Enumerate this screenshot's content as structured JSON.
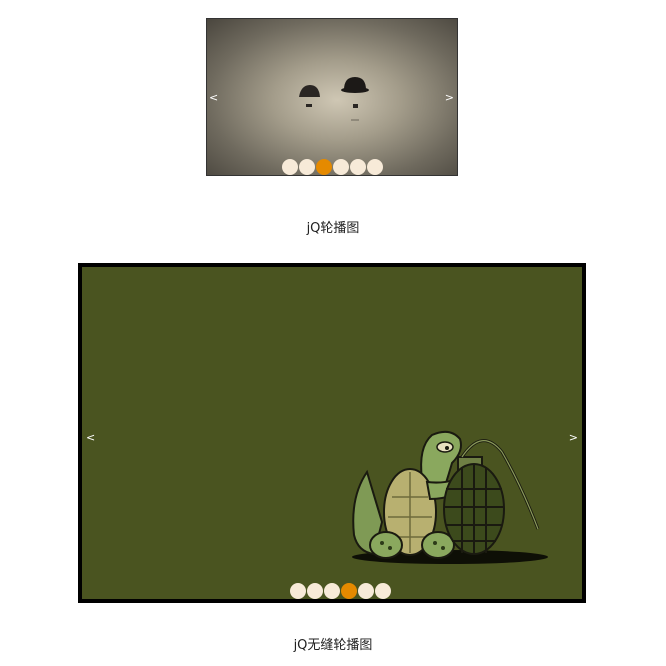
{
  "carousel1": {
    "prev_label": "<",
    "next_label": ">",
    "dot_count": 6,
    "active_index": 2,
    "caption": "jQ轮播图",
    "background_color": "#6f6a5e"
  },
  "carousel2": {
    "prev_label": "<",
    "next_label": ">",
    "dot_count": 6,
    "active_index": 3,
    "caption": "jQ无缝轮播图",
    "background_color": "#4a5420",
    "border_color": "#000000"
  },
  "colors": {
    "dot_inactive": "#f7ead8",
    "dot_active": "#e58a00"
  }
}
